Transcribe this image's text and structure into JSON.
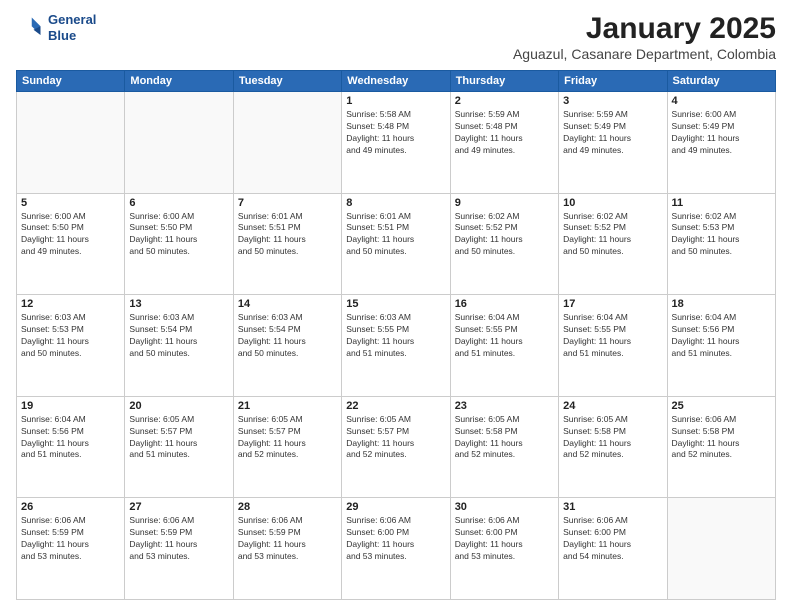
{
  "logo": {
    "line1": "General",
    "line2": "Blue"
  },
  "title": "January 2025",
  "subtitle": "Aguazul, Casanare Department, Colombia",
  "days_of_week": [
    "Sunday",
    "Monday",
    "Tuesday",
    "Wednesday",
    "Thursday",
    "Friday",
    "Saturday"
  ],
  "weeks": [
    [
      {
        "day": "",
        "info": ""
      },
      {
        "day": "",
        "info": ""
      },
      {
        "day": "",
        "info": ""
      },
      {
        "day": "1",
        "info": "Sunrise: 5:58 AM\nSunset: 5:48 PM\nDaylight: 11 hours\nand 49 minutes."
      },
      {
        "day": "2",
        "info": "Sunrise: 5:59 AM\nSunset: 5:48 PM\nDaylight: 11 hours\nand 49 minutes."
      },
      {
        "day": "3",
        "info": "Sunrise: 5:59 AM\nSunset: 5:49 PM\nDaylight: 11 hours\nand 49 minutes."
      },
      {
        "day": "4",
        "info": "Sunrise: 6:00 AM\nSunset: 5:49 PM\nDaylight: 11 hours\nand 49 minutes."
      }
    ],
    [
      {
        "day": "5",
        "info": "Sunrise: 6:00 AM\nSunset: 5:50 PM\nDaylight: 11 hours\nand 49 minutes."
      },
      {
        "day": "6",
        "info": "Sunrise: 6:00 AM\nSunset: 5:50 PM\nDaylight: 11 hours\nand 50 minutes."
      },
      {
        "day": "7",
        "info": "Sunrise: 6:01 AM\nSunset: 5:51 PM\nDaylight: 11 hours\nand 50 minutes."
      },
      {
        "day": "8",
        "info": "Sunrise: 6:01 AM\nSunset: 5:51 PM\nDaylight: 11 hours\nand 50 minutes."
      },
      {
        "day": "9",
        "info": "Sunrise: 6:02 AM\nSunset: 5:52 PM\nDaylight: 11 hours\nand 50 minutes."
      },
      {
        "day": "10",
        "info": "Sunrise: 6:02 AM\nSunset: 5:52 PM\nDaylight: 11 hours\nand 50 minutes."
      },
      {
        "day": "11",
        "info": "Sunrise: 6:02 AM\nSunset: 5:53 PM\nDaylight: 11 hours\nand 50 minutes."
      }
    ],
    [
      {
        "day": "12",
        "info": "Sunrise: 6:03 AM\nSunset: 5:53 PM\nDaylight: 11 hours\nand 50 minutes."
      },
      {
        "day": "13",
        "info": "Sunrise: 6:03 AM\nSunset: 5:54 PM\nDaylight: 11 hours\nand 50 minutes."
      },
      {
        "day": "14",
        "info": "Sunrise: 6:03 AM\nSunset: 5:54 PM\nDaylight: 11 hours\nand 50 minutes."
      },
      {
        "day": "15",
        "info": "Sunrise: 6:03 AM\nSunset: 5:55 PM\nDaylight: 11 hours\nand 51 minutes."
      },
      {
        "day": "16",
        "info": "Sunrise: 6:04 AM\nSunset: 5:55 PM\nDaylight: 11 hours\nand 51 minutes."
      },
      {
        "day": "17",
        "info": "Sunrise: 6:04 AM\nSunset: 5:55 PM\nDaylight: 11 hours\nand 51 minutes."
      },
      {
        "day": "18",
        "info": "Sunrise: 6:04 AM\nSunset: 5:56 PM\nDaylight: 11 hours\nand 51 minutes."
      }
    ],
    [
      {
        "day": "19",
        "info": "Sunrise: 6:04 AM\nSunset: 5:56 PM\nDaylight: 11 hours\nand 51 minutes."
      },
      {
        "day": "20",
        "info": "Sunrise: 6:05 AM\nSunset: 5:57 PM\nDaylight: 11 hours\nand 51 minutes."
      },
      {
        "day": "21",
        "info": "Sunrise: 6:05 AM\nSunset: 5:57 PM\nDaylight: 11 hours\nand 52 minutes."
      },
      {
        "day": "22",
        "info": "Sunrise: 6:05 AM\nSunset: 5:57 PM\nDaylight: 11 hours\nand 52 minutes."
      },
      {
        "day": "23",
        "info": "Sunrise: 6:05 AM\nSunset: 5:58 PM\nDaylight: 11 hours\nand 52 minutes."
      },
      {
        "day": "24",
        "info": "Sunrise: 6:05 AM\nSunset: 5:58 PM\nDaylight: 11 hours\nand 52 minutes."
      },
      {
        "day": "25",
        "info": "Sunrise: 6:06 AM\nSunset: 5:58 PM\nDaylight: 11 hours\nand 52 minutes."
      }
    ],
    [
      {
        "day": "26",
        "info": "Sunrise: 6:06 AM\nSunset: 5:59 PM\nDaylight: 11 hours\nand 53 minutes."
      },
      {
        "day": "27",
        "info": "Sunrise: 6:06 AM\nSunset: 5:59 PM\nDaylight: 11 hours\nand 53 minutes."
      },
      {
        "day": "28",
        "info": "Sunrise: 6:06 AM\nSunset: 5:59 PM\nDaylight: 11 hours\nand 53 minutes."
      },
      {
        "day": "29",
        "info": "Sunrise: 6:06 AM\nSunset: 6:00 PM\nDaylight: 11 hours\nand 53 minutes."
      },
      {
        "day": "30",
        "info": "Sunrise: 6:06 AM\nSunset: 6:00 PM\nDaylight: 11 hours\nand 53 minutes."
      },
      {
        "day": "31",
        "info": "Sunrise: 6:06 AM\nSunset: 6:00 PM\nDaylight: 11 hours\nand 54 minutes."
      },
      {
        "day": "",
        "info": ""
      }
    ]
  ]
}
